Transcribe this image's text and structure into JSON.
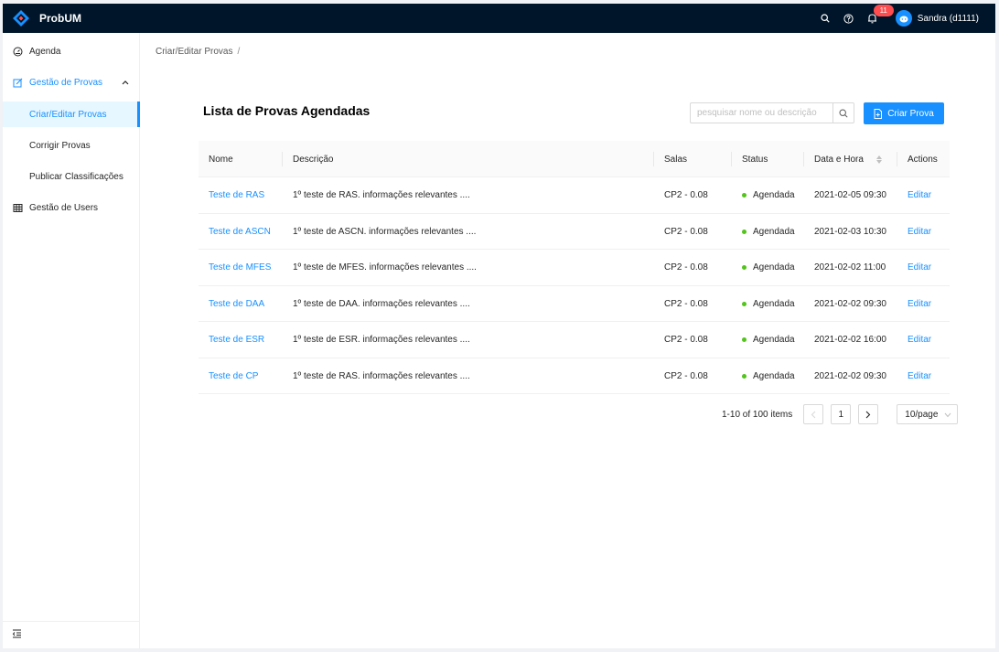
{
  "app": {
    "title": "ProbUM",
    "notifications_count": "11",
    "user_name": "Sandra (d1111)",
    "accent": "#1890ff",
    "header_bg": "#001529"
  },
  "header": {
    "icons": [
      "search-icon",
      "help-icon",
      "bell-icon"
    ]
  },
  "sidebar": {
    "items": [
      {
        "label": "Agenda",
        "icon": "dashboard-icon"
      },
      {
        "label": "Gestão de  Provas",
        "icon": "edit-icon"
      },
      {
        "label": "Criar/Editar Provas"
      },
      {
        "label": "Corrigir Provas"
      },
      {
        "label": "Publicar Classificações"
      },
      {
        "label": "Gestão de Users",
        "icon": "table-icon"
      }
    ],
    "footer_icon": "menu-fold-icon"
  },
  "breadcrumb": {
    "current": "Criar/Editar Provas",
    "separator": "/"
  },
  "main": {
    "title": "Lista de Provas Agendadas",
    "search_placeholder": "pesquisar nome ou descrição",
    "create_label": "Criar Prova"
  },
  "table": {
    "headers": [
      "Nome",
      "Descrição",
      "Salas",
      "Status",
      "Data e Hora",
      "Actions"
    ],
    "rows": [
      {
        "nome": "Teste de RAS",
        "descricao": "1º teste de RAS. informações relevantes ....",
        "salas": "CP2 - 0.08",
        "status": "Agendada",
        "data": "2021-02-05 09:30",
        "action": "Editar"
      },
      {
        "nome": "Teste de ASCN",
        "descricao": "1º teste de ASCN. informações relevantes ....",
        "salas": "CP2 - 0.08",
        "status": "Agendada",
        "data": "2021-02-03 10:30",
        "action": "Editar"
      },
      {
        "nome": "Teste de  MFES",
        "descricao": "1º teste de MFES. informações relevantes ....",
        "salas": "CP2 - 0.08",
        "status": "Agendada",
        "data": "2021-02-02 11:00",
        "action": "Editar"
      },
      {
        "nome": "Teste de DAA",
        "descricao": "1º teste de DAA. informações relevantes ....",
        "salas": "CP2 - 0.08",
        "status": "Agendada",
        "data": "2021-02-02 09:30",
        "action": "Editar"
      },
      {
        "nome": "Teste de ESR",
        "descricao": "1º teste de ESR. informações relevantes ....",
        "salas": "CP2 - 0.08",
        "status": "Agendada",
        "data": "2021-02-02 16:00",
        "action": "Editar"
      },
      {
        "nome": "Teste de CP",
        "descricao": "1º teste de RAS. informações relevantes ....",
        "salas": "CP2 - 0.08",
        "status": "Agendada",
        "data": "2021-02-02 09:30",
        "action": "Editar"
      }
    ]
  },
  "pagination": {
    "total": "1-10 of 100 items",
    "current_page": "1",
    "page_size": "10/page"
  }
}
